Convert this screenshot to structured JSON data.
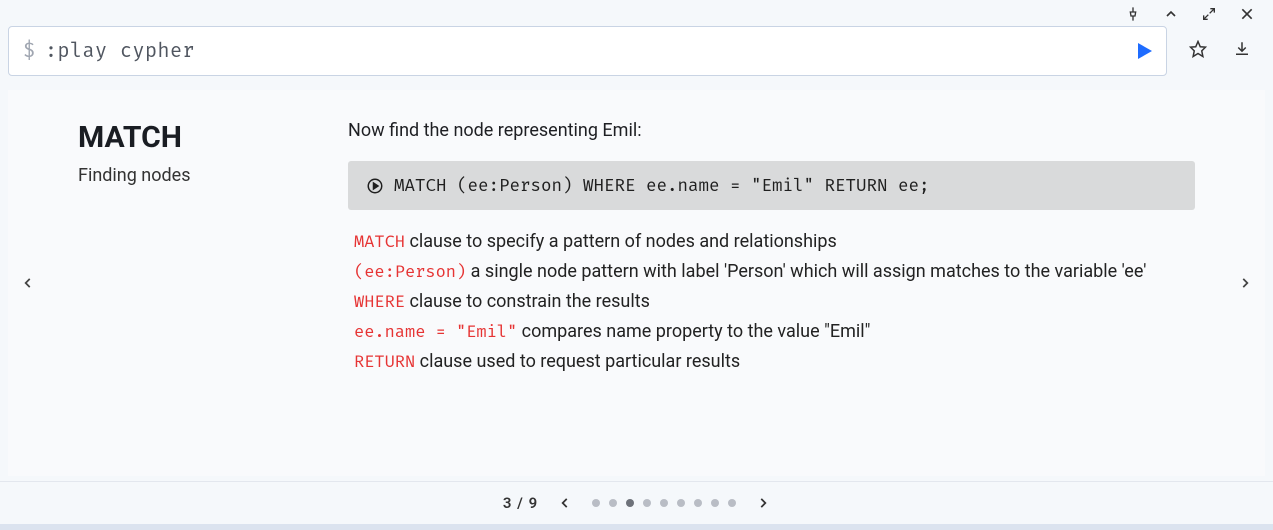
{
  "toolbar": {
    "pin_icon": "pin",
    "collapse_icon": "chevron-up",
    "expand_icon": "expand",
    "close_icon": "close"
  },
  "command": {
    "prompt": "$",
    "text": ":play cypher",
    "run_icon": "play",
    "favorite_icon": "star",
    "download_icon": "download"
  },
  "page": {
    "heading": "MATCH",
    "subtitle": "Finding nodes",
    "intro": "Now find the node representing Emil:",
    "code": "MATCH (ee:Person) WHERE ee.name = \"Emil\" RETURN ee;",
    "bullets": [
      {
        "code": "MATCH",
        "text": " clause to specify a pattern of nodes and relationships"
      },
      {
        "code": "(ee:Person)",
        "text": " a single node pattern with label 'Person' which will assign matches to the variable 'ee'"
      },
      {
        "code": "WHERE",
        "text": " clause to constrain the results"
      },
      {
        "code": "ee.name = \"Emil\"",
        "text": " compares name property to the value \"Emil\""
      },
      {
        "code": "RETURN",
        "text": " clause used to request particular results"
      }
    ]
  },
  "pagination": {
    "current": 3,
    "total": 9,
    "label": "3 / 9"
  }
}
